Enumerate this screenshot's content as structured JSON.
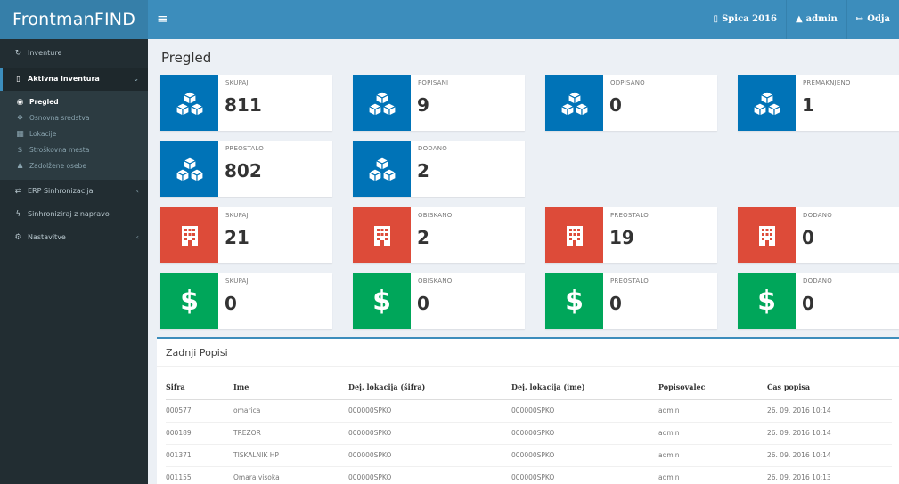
{
  "brand": {
    "name": "FrontmanFIND"
  },
  "topbar": {
    "menu_icon": "bars-icon",
    "items": [
      {
        "label": "Spica 2016",
        "icon": "file-icon"
      },
      {
        "label": "admin",
        "icon": "user-icon"
      },
      {
        "label": "Odja",
        "icon": "sign-out-icon"
      }
    ]
  },
  "sidebar": {
    "inventure": "Inventure",
    "active_section": "Aktivna inventura",
    "sub_items": [
      {
        "label": "Pregled",
        "icon": "dashboard-icon"
      },
      {
        "label": "Osnovna sredstva",
        "icon": "cubes-icon"
      },
      {
        "label": "Lokacije",
        "icon": "building-icon"
      },
      {
        "label": "Stroškovna mesta",
        "icon": "dollar-icon"
      },
      {
        "label": "Zadolžene osebe",
        "icon": "user-icon"
      }
    ],
    "erp": "ERP Sinhronizacija",
    "sync": "Sinhroniziraj z napravo",
    "settings": "Nastavitve"
  },
  "page": {
    "title": "Pregled"
  },
  "stats": {
    "assets": [
      {
        "label": "SKUPAJ",
        "value": "811"
      },
      {
        "label": "POPISANI",
        "value": "9"
      },
      {
        "label": "ODPISANO",
        "value": "0"
      },
      {
        "label": "PREMAKNJENO",
        "value": "1"
      },
      {
        "label": "PREOSTALO",
        "value": "802"
      },
      {
        "label": "DODANO",
        "value": "2"
      }
    ],
    "locations": [
      {
        "label": "SKUPAJ",
        "value": "21"
      },
      {
        "label": "OBISKANO",
        "value": "2"
      },
      {
        "label": "PREOSTALO",
        "value": "19"
      },
      {
        "label": "DODANO",
        "value": "0"
      }
    ],
    "cost_centers": [
      {
        "label": "SKUPAJ",
        "value": "0"
      },
      {
        "label": "OBISKANO",
        "value": "0"
      },
      {
        "label": "PREOSTALO",
        "value": "0"
      },
      {
        "label": "DODANO",
        "value": "0"
      }
    ]
  },
  "colors": {
    "blue": "#0073b7",
    "red": "#dd4b39",
    "green": "#00a65a",
    "header": "#3c8dbc",
    "sidebar": "#222d32"
  },
  "recent": {
    "title": "Zadnji Popisi",
    "headers": [
      "Šifra",
      "Ime",
      "Dej. lokacija (šifra)",
      "Dej. lokacija (ime)",
      "Popisovalec",
      "Čas popisa"
    ],
    "rows": [
      [
        "000577",
        "omarica",
        "000000SPKO",
        "000000SPKO",
        "admin",
        "26. 09. 2016 10:14"
      ],
      [
        "000189",
        "TREZOR",
        "000000SPKO",
        "000000SPKO",
        "admin",
        "26. 09. 2016 10:14"
      ],
      [
        "001371",
        "TISKALNIK HP",
        "000000SPKO",
        "000000SPKO",
        "admin",
        "26. 09. 2016 10:14"
      ],
      [
        "001155",
        "Omara visoka",
        "000000SPKO",
        "000000SPKO",
        "admin",
        "26. 09. 2016 10:13"
      ]
    ]
  }
}
